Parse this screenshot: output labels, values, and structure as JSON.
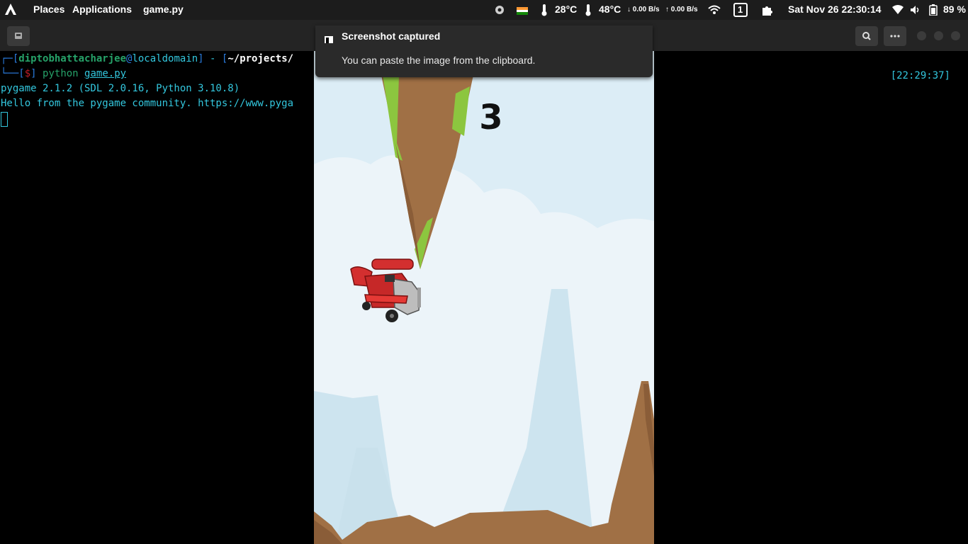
{
  "topbar": {
    "places": "Places",
    "applications": "Applications",
    "active_app": "game.py",
    "temp_cpu": "28°C",
    "temp_gpu": "48°C",
    "net_down": "↓ 0.00 B/s",
    "net_up": "↑ 0.00 B/s",
    "workspace": "1",
    "clock": "Sat Nov 26  22:30:14",
    "battery": "89 %"
  },
  "terminal": {
    "user": "diptobhattacharjee",
    "at": "@",
    "host": "localdomain",
    "sep": " - ",
    "path": "~/projects/",
    "prompt": "$",
    "command": "python",
    "arg": "game.py",
    "output_1": "pygame 2.1.2 (SDL 2.0.16, Python 3.10.8)",
    "output_2": "Hello from the pygame community. https://www.pyga",
    "time": "[22:29:37]"
  },
  "game": {
    "score": "3"
  },
  "notification": {
    "title": "Screenshot captured",
    "body": "You can paste the image from the clipboard."
  },
  "colors": {
    "sky": "#dcedf6",
    "rock": "#a07045",
    "grass": "#8cc63f",
    "plane_red": "#d32f2f"
  }
}
